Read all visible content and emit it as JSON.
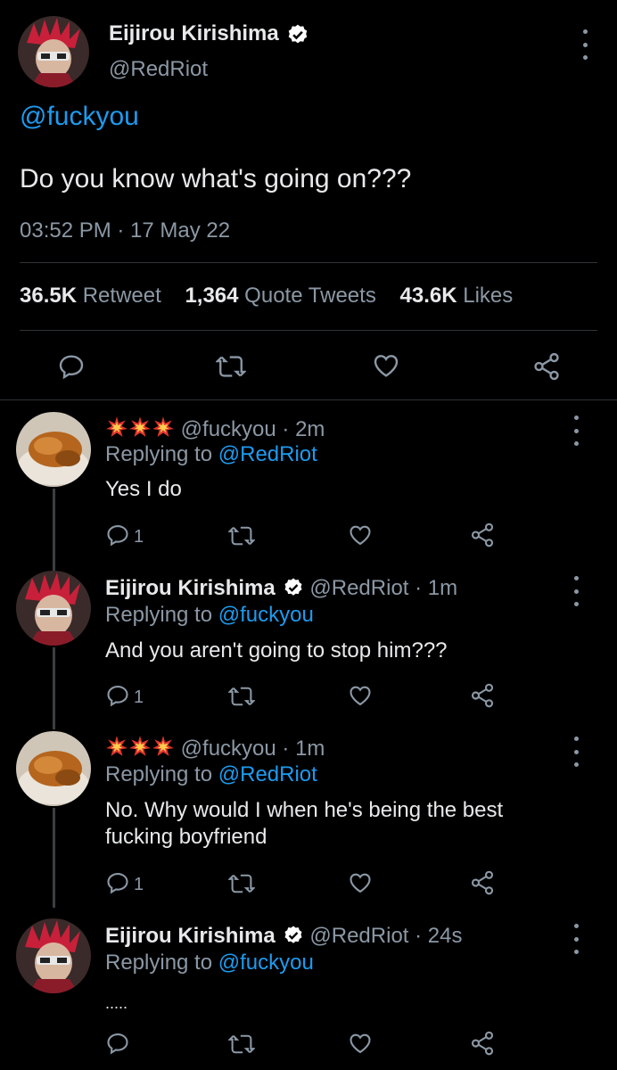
{
  "main_tweet": {
    "author_name": "Eijirou Kirishima",
    "author_handle": "@RedRiot",
    "mention": "@fuckyou",
    "text": "Do you know what's going on???",
    "timestamp": "03:52 PM · 17 May 22",
    "stats": {
      "retweets_count": "36.5K",
      "retweets_label": "Retweet",
      "quotes_count": "1,364",
      "quotes_label": "Quote Tweets",
      "likes_count": "43.6K",
      "likes_label": "Likes"
    },
    "actions": [
      "reply-icon",
      "retweet-icon",
      "like-icon",
      "share-icon"
    ]
  },
  "replies": [
    {
      "handle_time": "@fuckyou · 2m",
      "replying_prefix": "Replying to",
      "replying_to": "@RedRiot",
      "text": "Yes I do",
      "reply_count": "1"
    },
    {
      "author_name": "Eijirou Kirishima",
      "handle_time": "@RedRiot · 1m",
      "replying_prefix": "Replying to",
      "replying_to": "@fuckyou",
      "text": "And you aren't going to stop him???",
      "reply_count": "1"
    },
    {
      "handle_time": "@fuckyou · 1m",
      "replying_prefix": "Replying to",
      "replying_to": "@RedRiot",
      "text": "No. Why would I when he's being the best fucking boyfriend",
      "reply_count": "1"
    },
    {
      "author_name": "Eijirou Kirishima",
      "handle_time": "@RedRiot · 24s",
      "replying_prefix": "Replying to",
      "replying_to": "@fuckyou",
      "text": ".....",
      "reply_count": ""
    }
  ],
  "colors": {
    "background": "#000000",
    "text_primary": "#e7e9ea",
    "text_secondary": "#8b98a5",
    "link": "#1d9bf0",
    "verified": "#ffffff"
  }
}
